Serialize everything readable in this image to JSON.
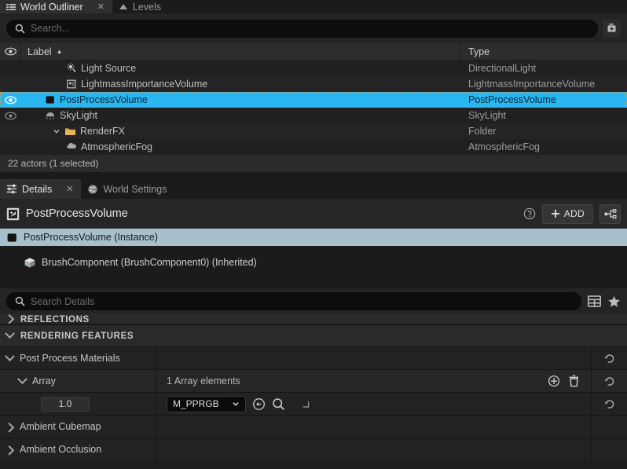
{
  "outliner": {
    "tabs": [
      {
        "label": "World Outliner",
        "icon": "outliner-icon",
        "active": true,
        "closable": true
      },
      {
        "label": "Levels",
        "icon": "levels-icon",
        "active": false,
        "closable": false
      }
    ],
    "search": {
      "placeholder": "Search...",
      "value": ""
    },
    "create_folder_icon": "new-folder-icon",
    "columns": {
      "eye": "visibility",
      "label": "Label",
      "type": "Type",
      "sort_indicator": "▲"
    },
    "rows": [
      {
        "label": "Light Source",
        "type": "DirectionalLight",
        "icon": "directional-light-icon",
        "indent": 2,
        "eye": "none",
        "selected": false
      },
      {
        "label": "LightmassImportanceVolume",
        "type": "LightmassImportanceVolume",
        "icon": "lightmass-volume-icon",
        "indent": 2,
        "eye": "none",
        "selected": false
      },
      {
        "label": "PostProcessVolume",
        "type": "PostProcessVolume",
        "icon": "postprocess-volume-icon",
        "indent": 2,
        "eye": "visible",
        "selected": true
      },
      {
        "label": "SkyLight",
        "type": "SkyLight",
        "icon": "skylight-icon",
        "indent": 2,
        "eye": "dim",
        "selected": false
      },
      {
        "label": "RenderFX",
        "type": "Folder",
        "icon": "folder-icon",
        "indent": 1,
        "eye": "none",
        "selected": false,
        "expanded": true
      },
      {
        "label": "AtmosphericFog",
        "type": "AtmosphericFog",
        "icon": "fog-icon",
        "indent": 2,
        "eye": "none",
        "selected": false
      }
    ],
    "status": "22 actors (1 selected)"
  },
  "details": {
    "tabs": [
      {
        "label": "Details",
        "icon": "details-icon",
        "active": true,
        "closable": true
      },
      {
        "label": "World Settings",
        "icon": "world-settings-icon",
        "active": false,
        "closable": false
      }
    ],
    "title": "PostProcessVolume",
    "title_icon": "postprocess-volume-icon",
    "help_icon": "help-icon",
    "add_label": "ADD",
    "add_icon": "plus-icon",
    "blueprint_icon": "blueprint-graph-icon",
    "components": [
      {
        "label": "PostProcessVolume (Instance)",
        "icon": "postprocess-volume-icon",
        "indent": 0,
        "selected": true
      },
      {
        "label": "BrushComponent (BrushComponent0) (Inherited)",
        "icon": "brush-component-icon",
        "indent": 1,
        "selected": false
      }
    ],
    "search": {
      "placeholder": "Search Details",
      "value": ""
    },
    "search_icons": [
      "grid-view-icon",
      "favorites-star-icon"
    ],
    "categories": [
      {
        "name": "REFLECTIONS",
        "expanded": false,
        "clipped": true
      },
      {
        "name": "RENDERING FEATURES",
        "expanded": true,
        "clipped": false
      }
    ],
    "properties": [
      {
        "kind": "group",
        "name": "Post Process Materials",
        "expanded": true,
        "indent": 0,
        "value": "",
        "reset_icon": "revert-arrow-icon"
      },
      {
        "kind": "array",
        "name": "Array",
        "expanded": true,
        "indent": 1,
        "value": "1 Array elements",
        "add_element_icon": "add-circle-icon",
        "delete_all_icon": "trash-icon",
        "reset_icon": "revert-arrow-icon"
      },
      {
        "kind": "element",
        "name": "",
        "indent": 2,
        "weight": "1.0",
        "asset": "M_PPRGB",
        "asset_dropdown_icon": "chevron-down-icon",
        "browse_icon": "use-selected-asset-icon",
        "find_icon": "browse-to-asset-icon",
        "expand_icon": "asset-picker-icon",
        "reset_icon": "revert-arrow-icon"
      },
      {
        "kind": "collapsed",
        "name": "Ambient Cubemap",
        "expanded": false,
        "indent": 0,
        "value": ""
      },
      {
        "kind": "collapsed",
        "name": "Ambient Occlusion",
        "expanded": false,
        "indent": 0,
        "value": ""
      }
    ]
  },
  "colors": {
    "selection_blue": "#2ab6f0",
    "component_selection": "#a8c0cc",
    "panel_bg": "#1f1f1f",
    "folder_orange": "#d8a13f"
  }
}
